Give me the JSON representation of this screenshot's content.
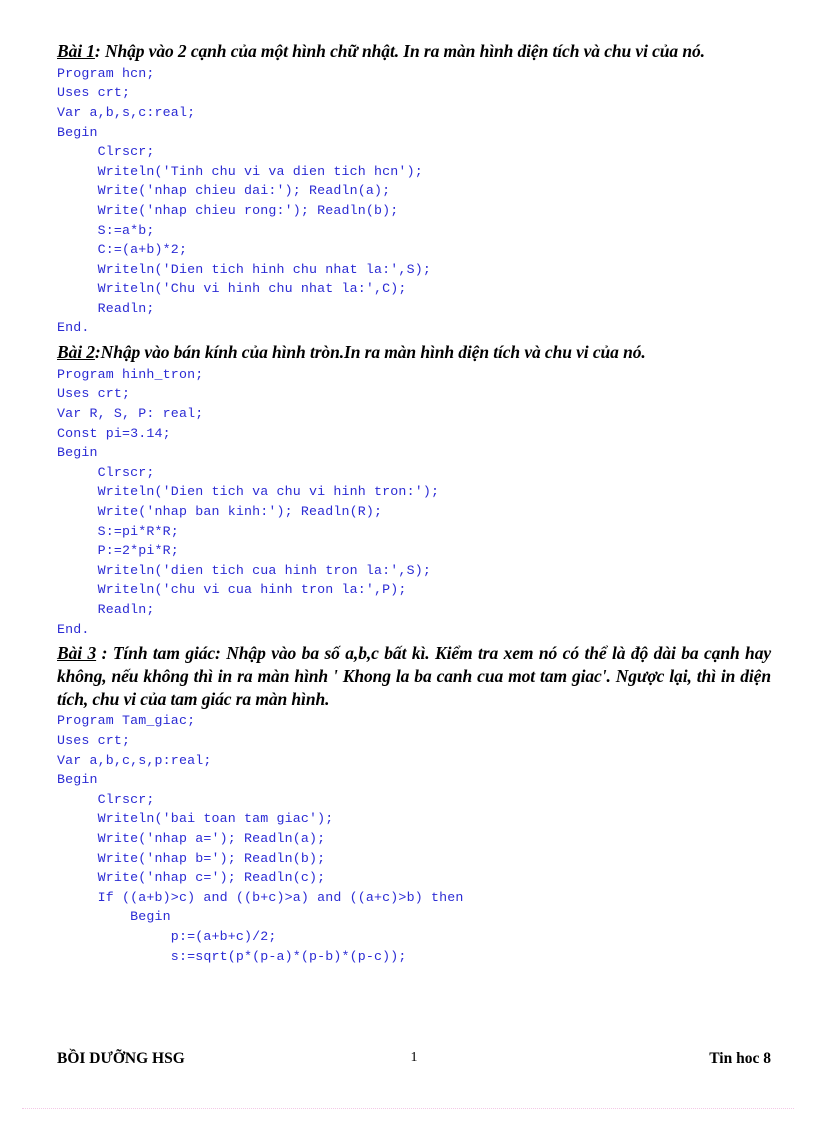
{
  "document": {
    "language": "vi",
    "body_text_color": "#000000",
    "code_text_color": "#2b2bd4",
    "page_background": "#ffffff"
  },
  "exercises": [
    {
      "label": "Bài 1",
      "separator": ": ",
      "prompt": "Nhập vào 2 cạnh của một hình chữ nhật. In ra màn hình diện tích và chu vi của nó.",
      "code": [
        "Program hcn;",
        "Uses crt;",
        "Var a,b,s,c:real;",
        "Begin",
        "     Clrscr;",
        "     Writeln('Tinh chu vi va dien tich hcn');",
        "     Write('nhap chieu dai:'); Readln(a);",
        "     Write('nhap chieu rong:'); Readln(b);",
        "     S:=a*b;",
        "     C:=(a+b)*2;",
        "     Writeln('Dien tich hinh chu nhat la:',S);",
        "     Writeln('Chu vi hinh chu nhat la:',C);",
        "     Readln;",
        "End."
      ]
    },
    {
      "label": "Bài 2",
      "separator": ":",
      "prompt": "Nhập vào bán kính của hình tròn.In ra màn hình diện tích và chu vi của nó.",
      "code": [
        "Program hinh_tron;",
        "Uses crt;",
        "Var R, S, P: real;",
        "Const pi=3.14;",
        "Begin",
        "     Clrscr;",
        "     Writeln('Dien tich va chu vi hinh tron:');",
        "     Write('nhap ban kinh:'); Readln(R);",
        "     S:=pi*R*R;",
        "     P:=2*pi*R;",
        "     Writeln('dien tich cua hinh tron la:',S);",
        "     Writeln('chu vi cua hinh tron la:',P);",
        "     Readln;",
        "End."
      ]
    },
    {
      "label": "Bài 3",
      "separator": " : ",
      "prompt": "Tính tam giác: Nhập vào ba số a,b,c bất kì. Kiểm tra xem nó có thể  là độ dài ba cạnh hay không, nếu không thì in ra màn hình ' Khong la ba canh cua mot tam giac'. Ngược lại, thì in diện tích, chu vi của tam giác ra màn hình.",
      "code": [
        "Program Tam_giac;",
        "Uses crt;",
        "Var a,b,c,s,p:real;",
        "Begin",
        "     Clrscr;",
        "     Writeln('bai toan tam giac');",
        "     Write('nhap a='); Readln(a);",
        "     Write('nhap b='); Readln(b);",
        "     Write('nhap c='); Readln(c);",
        "     If ((a+b)>c) and ((b+c)>a) and ((a+c)>b) then",
        "         Begin",
        "              p:=(a+b+c)/2;",
        "              s:=sqrt(p*(p-a)*(p-b)*(p-c));"
      ]
    }
  ],
  "footer": {
    "left": "BỒI DƯỠNG HSG",
    "page_number": "1",
    "right": "Tin hoc 8"
  }
}
